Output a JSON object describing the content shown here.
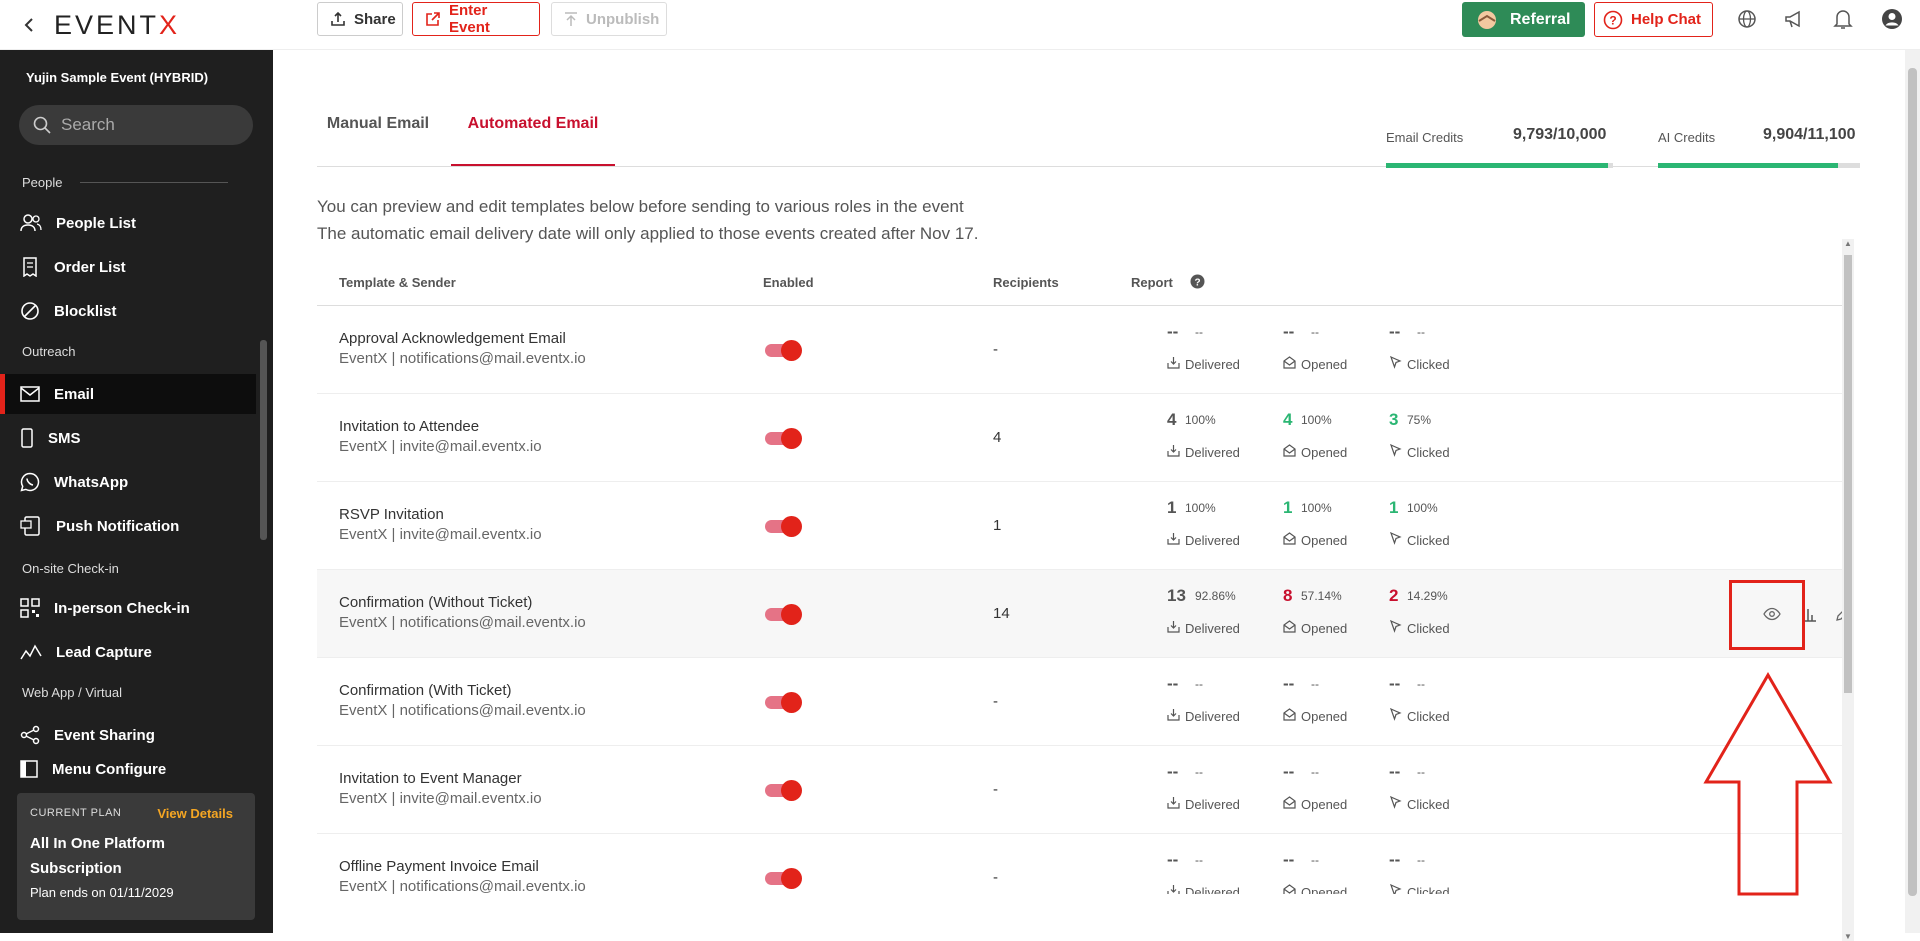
{
  "header": {
    "logo": "EVENTX",
    "share_label": "Share",
    "enter_event_label": "Enter Event",
    "unpublish_label": "Unpublish",
    "referral_label": "Referral",
    "help_chat_label": "Help Chat"
  },
  "sidebar": {
    "event_name": "Yujin Sample Event (HYBRID)",
    "search_placeholder": "Search",
    "sections": {
      "people": "People",
      "outreach": "Outreach",
      "onsite": "On-site Check-in",
      "webapp": "Web App / Virtual"
    },
    "items": [
      {
        "label": "People List",
        "icon": "people-icon"
      },
      {
        "label": "Order List",
        "icon": "receipt-icon"
      },
      {
        "label": "Blocklist",
        "icon": "block-icon"
      },
      {
        "label": "Email",
        "icon": "mail-icon",
        "active": true
      },
      {
        "label": "SMS",
        "icon": "phone-icon"
      },
      {
        "label": "WhatsApp",
        "icon": "whatsapp-icon"
      },
      {
        "label": "Push Notification",
        "icon": "push-icon"
      },
      {
        "label": "In-person Check-in",
        "icon": "qr-icon"
      },
      {
        "label": "Lead Capture",
        "icon": "lead-icon"
      },
      {
        "label": "Event Sharing",
        "icon": "share-icon"
      },
      {
        "label": "Menu Configure",
        "icon": "menu-icon"
      }
    ],
    "plan": {
      "label": "CURRENT PLAN",
      "view_details": "View Details",
      "name": "All In One Platform Subscription",
      "ends": "Plan ends on 01/11/2029"
    }
  },
  "main": {
    "tabs": [
      "Manual Email",
      "Automated Email"
    ],
    "active_tab": "Automated Email",
    "email_credits_label": "Email Credits",
    "email_credits_value": "9,793/10,000",
    "email_credits_fraction": 0.979,
    "ai_credits_label": "AI Credits",
    "ai_credits_value": "9,904/11,100",
    "ai_credits_fraction": 0.892,
    "info_line1": "You can preview and edit templates below before sending to various roles in the event",
    "info_line2": "The automatic email delivery date will only applied to those events created after Nov 17.",
    "columns": {
      "template": "Template & Sender",
      "enabled": "Enabled",
      "recipients": "Recipients",
      "report": "Report"
    },
    "metric_labels": {
      "delivered": "Delivered",
      "opened": "Opened",
      "clicked": "Clicked"
    },
    "rows": [
      {
        "name": "Approval Acknowledgement Email",
        "sender": "EventX | notifications@mail.eventx.io",
        "recipients": "-",
        "delivered": "--",
        "delivered_pct": "--",
        "opened": "--",
        "opened_pct": "--",
        "clicked": "--",
        "clicked_pct": "--"
      },
      {
        "name": "Invitation to Attendee",
        "sender": "EventX | invite@mail.eventx.io",
        "recipients": "4",
        "delivered": "4",
        "delivered_pct": "100%",
        "opened": "4",
        "opened_pct": "100%",
        "clicked": "3",
        "clicked_pct": "75%"
      },
      {
        "name": "RSVP Invitation",
        "sender": "EventX | invite@mail.eventx.io",
        "recipients": "1",
        "delivered": "1",
        "delivered_pct": "100%",
        "opened": "1",
        "opened_pct": "100%",
        "clicked": "1",
        "clicked_pct": "100%"
      },
      {
        "name": "Confirmation (Without Ticket)",
        "sender": "EventX | notifications@mail.eventx.io",
        "recipients": "14",
        "delivered": "13",
        "delivered_pct": "92.86%",
        "opened": "8",
        "opened_pct": "57.14%",
        "clicked": "2",
        "clicked_pct": "14.29%"
      },
      {
        "name": "Confirmation (With Ticket)",
        "sender": "EventX | notifications@mail.eventx.io",
        "recipients": "-",
        "delivered": "--",
        "delivered_pct": "--",
        "opened": "--",
        "opened_pct": "--",
        "clicked": "--",
        "clicked_pct": "--"
      },
      {
        "name": "Invitation to Event Manager",
        "sender": "EventX | invite@mail.eventx.io",
        "recipients": "-",
        "delivered": "--",
        "delivered_pct": "--",
        "opened": "--",
        "opened_pct": "--",
        "clicked": "--",
        "clicked_pct": "--"
      },
      {
        "name": "Offline Payment Invoice Email",
        "sender": "EventX | notifications@mail.eventx.io",
        "recipients": "-",
        "delivered": "--",
        "delivered_pct": "--",
        "opened": "--",
        "opened_pct": "--",
        "clicked": "--",
        "clicked_pct": "--"
      }
    ]
  },
  "colors": {
    "brand_red": "#e2231a",
    "sidebar_bg": "#1f1f1f",
    "referral_green": "#2e8b57",
    "credit_green": "#2bb673"
  }
}
